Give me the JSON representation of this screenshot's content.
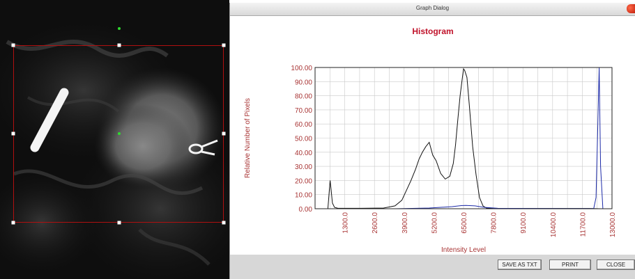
{
  "dialog": {
    "title": "Graph Dialog",
    "buttons": {
      "save_txt": "SAVE AS TXT",
      "print": "PRINT",
      "close": "CLOSE"
    }
  },
  "colors": {
    "title_red": "#c0122a",
    "axis_text_red": "#a83434",
    "series_black": "#111111",
    "series_blue": "#1c2aa8",
    "roi_red": "#b01010"
  },
  "chart_data": {
    "type": "line",
    "title": "Histogram",
    "xlabel": "Intensity Level",
    "ylabel": "Relative Number of Pixels",
    "xlim": [
      0,
      13000
    ],
    "ylim": [
      0,
      100
    ],
    "x_ticks": [
      "1300.0",
      "2600.0",
      "3900.0",
      "5200.0",
      "6500.0",
      "7800.0",
      "9100.0",
      "10400.0",
      "11700.0",
      "13000.0"
    ],
    "y_ticks": [
      "0.00",
      "10.00",
      "20.00",
      "30.00",
      "40.00",
      "50.00",
      "60.00",
      "70.00",
      "80.00",
      "90.00",
      "100.00"
    ],
    "grid": true,
    "series": [
      {
        "color": "#111111",
        "x": [
          0,
          560,
          620,
          660,
          700,
          760,
          850,
          1000,
          2000,
          3000,
          3500,
          3800,
          4000,
          4200,
          4400,
          4550,
          4700,
          4850,
          5000,
          5050,
          5150,
          5300,
          5500,
          5700,
          5900,
          6050,
          6150,
          6250,
          6350,
          6450,
          6500,
          6550,
          6650,
          6750,
          6900,
          7050,
          7200,
          7350,
          7500,
          8000,
          9000,
          10000,
          11000,
          12000,
          12500,
          13000
        ],
        "y": [
          0,
          0,
          12,
          20,
          14,
          4,
          1,
          0.3,
          0.3,
          0.5,
          2,
          6,
          13,
          20,
          28,
          35,
          40,
          44,
          47,
          44,
          38,
          34,
          25,
          21,
          23,
          32,
          45,
          63,
          80,
          93,
          99,
          98,
          93,
          74,
          44,
          24,
          8,
          2,
          0.5,
          0.2,
          0.2,
          0.2,
          0.2,
          0.2,
          0,
          0
        ]
      },
      {
        "color": "#1c2aa8",
        "x": [
          0,
          1000,
          3500,
          5000,
          6000,
          6400,
          6600,
          7000,
          7400,
          8000,
          11000,
          12200,
          12300,
          12380,
          12440,
          12500,
          12600,
          13000
        ],
        "y": [
          0,
          0,
          0,
          0.5,
          1.5,
          2.2,
          2.3,
          2,
          1,
          0.3,
          0.1,
          0.2,
          8,
          60,
          100,
          30,
          0,
          0
        ]
      }
    ]
  }
}
